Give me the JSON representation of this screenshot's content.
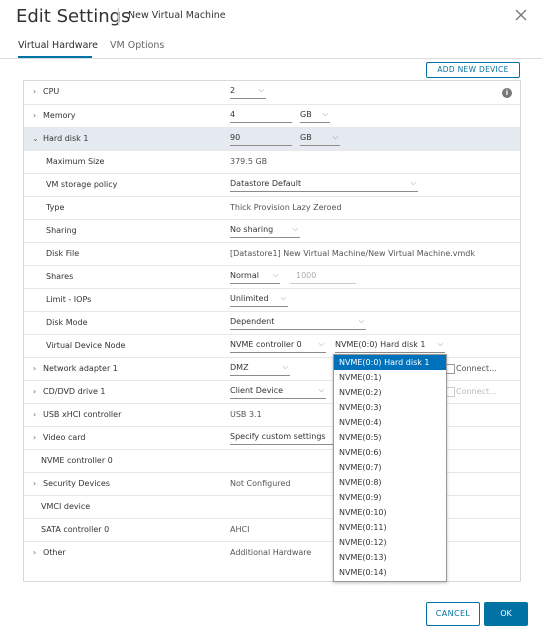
{
  "header": {
    "title": "Edit Settings",
    "subtitle": "New Virtual Machine"
  },
  "tabs": [
    {
      "label": "Virtual Hardware"
    },
    {
      "label": "VM Options"
    }
  ],
  "toolbar": {
    "add_device": "ADD NEW DEVICE"
  },
  "rows": {
    "cpu": {
      "label": "CPU",
      "value": "2"
    },
    "memory": {
      "label": "Memory",
      "value": "4",
      "unit": "GB"
    },
    "hard_disk": {
      "label": "Hard disk 1",
      "value": "90",
      "unit": "GB"
    },
    "max_size": {
      "label": "Maximum Size",
      "value": "379.5 GB"
    },
    "storage_policy": {
      "label": "VM storage policy",
      "value": "Datastore Default"
    },
    "type": {
      "label": "Type",
      "value": "Thick Provision Lazy Zeroed"
    },
    "sharing": {
      "label": "Sharing",
      "value": "No sharing"
    },
    "disk_file": {
      "label": "Disk File",
      "value": "[Datastore1] New Virtual Machine/New Virtual Machine.vmdk"
    },
    "shares": {
      "label": "Shares",
      "value": "Normal",
      "number": "1000"
    },
    "limit_iops": {
      "label": "Limit - IOPs",
      "value": "Unlimited"
    },
    "disk_mode": {
      "label": "Disk Mode",
      "value": "Dependent"
    },
    "vdn": {
      "label": "Virtual Device Node",
      "controller": "NVME controller 0",
      "node": "NVME(0:0) Hard disk 1"
    },
    "network": {
      "label": "Network adapter 1",
      "value": "DMZ",
      "connect": "Connect..."
    },
    "cdrom": {
      "label": "CD/DVD drive 1",
      "value": "Client Device",
      "connect": "Connect..."
    },
    "usb": {
      "label": "USB xHCI controller",
      "value": "USB 3.1"
    },
    "video": {
      "label": "Video card",
      "value": "Specify custom settings"
    },
    "nvme": {
      "label": "NVME controller 0"
    },
    "security": {
      "label": "Security Devices",
      "value": "Not Configured"
    },
    "vmci": {
      "label": "VMCI device"
    },
    "sata": {
      "label": "SATA controller 0",
      "value": "AHCI"
    },
    "other": {
      "label": "Other",
      "value": "Additional Hardware"
    }
  },
  "dropdown": {
    "options": [
      "NVME(0:0) Hard disk 1",
      "NVME(0:1)",
      "NVME(0:2)",
      "NVME(0:3)",
      "NVME(0:4)",
      "NVME(0:5)",
      "NVME(0:6)",
      "NVME(0:7)",
      "NVME(0:8)",
      "NVME(0:9)",
      "NVME(0:10)",
      "NVME(0:11)",
      "NVME(0:12)",
      "NVME(0:13)",
      "NVME(0:14)"
    ]
  },
  "footer": {
    "cancel": "CANCEL",
    "ok": "OK"
  },
  "colors": {
    "accent": "#0072a3",
    "highlight_row": "#e4eaf0",
    "dropdown_selected": "#0072bc"
  }
}
